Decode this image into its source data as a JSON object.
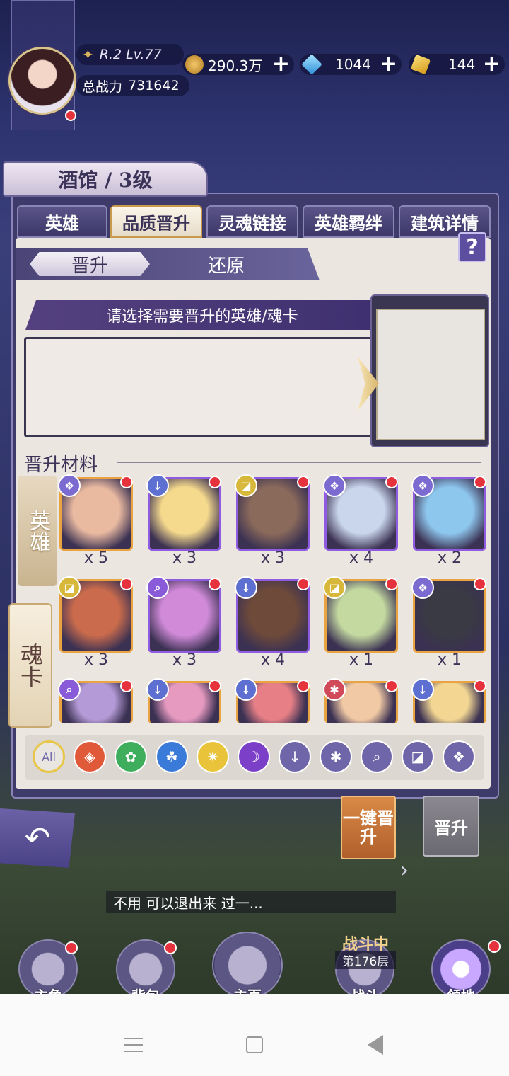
{
  "player": {
    "rank": "R.2 Lv.77",
    "power_label": "总战力",
    "power": "731642"
  },
  "currency": {
    "gold": "290.3万",
    "gems": "1044",
    "tickets": "144",
    "plus": "+"
  },
  "building": {
    "title": "酒馆 / 3级"
  },
  "tabs": [
    "英雄",
    "品质晋升",
    "灵魂链接",
    "英雄羁绊",
    "建筑详情"
  ],
  "help": "?",
  "subtabs": {
    "ascend": "晋升",
    "restore": "还原"
  },
  "select_prompt": "请选择需要晋升的英雄/魂卡",
  "materials_title": "晋升材料",
  "side_tabs": {
    "hero": "英雄",
    "soul_card": "魂卡"
  },
  "heroes": [
    {
      "qty": "x 5",
      "class": "wing",
      "frame": "gold",
      "color": "#e9b9a0"
    },
    {
      "qty": "x 3",
      "class": "dagger",
      "frame": "purple",
      "color": "#f5d98c"
    },
    {
      "qty": "x 3",
      "class": "mask",
      "frame": "purple",
      "color": "#8a6a5a"
    },
    {
      "qty": "x 4",
      "class": "wing",
      "frame": "purple",
      "color": "#c9d6ec"
    },
    {
      "qty": "x 2",
      "class": "wing",
      "frame": "purple",
      "color": "#8ec7ee"
    },
    {
      "qty": "x 3",
      "class": "mask",
      "frame": "gold",
      "color": "#c96b4c"
    },
    {
      "qty": "x 3",
      "class": "search",
      "frame": "purple",
      "color": "#d08ad8"
    },
    {
      "qty": "x 4",
      "class": "dagger",
      "frame": "purple",
      "color": "#6e4a3a"
    },
    {
      "qty": "x 1",
      "class": "mask",
      "frame": "gold",
      "color": "#c4d9a0"
    },
    {
      "qty": "x 1",
      "class": "wing",
      "frame": "gold",
      "color": "#3a3a44"
    },
    {
      "qty": "",
      "class": "search",
      "frame": "gold",
      "color": "#b49ad6"
    },
    {
      "qty": "",
      "class": "dagger",
      "frame": "gold",
      "color": "#e79ac0"
    },
    {
      "qty": "",
      "class": "dagger",
      "frame": "gold",
      "color": "#e67f86"
    },
    {
      "qty": "",
      "class": "shuriken",
      "frame": "gold",
      "color": "#f1c9a4"
    },
    {
      "qty": "",
      "class": "dagger",
      "frame": "gold",
      "color": "#f2d692"
    }
  ],
  "filters": [
    {
      "label": "All",
      "icon": "all-icon",
      "color": "#e9e5e0"
    },
    {
      "label": "",
      "icon": "fire-element-icon",
      "color": "#e05a3a"
    },
    {
      "label": "",
      "icon": "nature-element-icon",
      "color": "#3fae5c"
    },
    {
      "label": "",
      "icon": "water-element-icon",
      "color": "#3a7ad8"
    },
    {
      "label": "",
      "icon": "light-element-icon",
      "color": "#e9c43a"
    },
    {
      "label": "",
      "icon": "dark-element-icon",
      "color": "#7b3fc8"
    },
    {
      "label": "",
      "icon": "dagger-class-icon",
      "color": "#6e66a8"
    },
    {
      "label": "",
      "icon": "shuriken-class-icon",
      "color": "#6e66a8"
    },
    {
      "label": "",
      "icon": "search-class-icon",
      "color": "#6e66a8"
    },
    {
      "label": "",
      "icon": "mask-class-icon",
      "color": "#6e66a8"
    },
    {
      "label": "",
      "icon": "wing-class-icon",
      "color": "#6e66a8"
    }
  ],
  "buttons": {
    "quick_ascend": "一键晋升",
    "ascend": "晋升"
  },
  "chat": "不用 可以退出来 过一...",
  "battle": {
    "status": "战斗中",
    "floor": "第176层"
  },
  "nav": [
    "主角",
    "背包",
    "主页",
    "战斗",
    "领地"
  ],
  "colors": {
    "accent": "#5d4ea0",
    "gold_frame": "#e9a441",
    "badge": "#e5323c"
  }
}
